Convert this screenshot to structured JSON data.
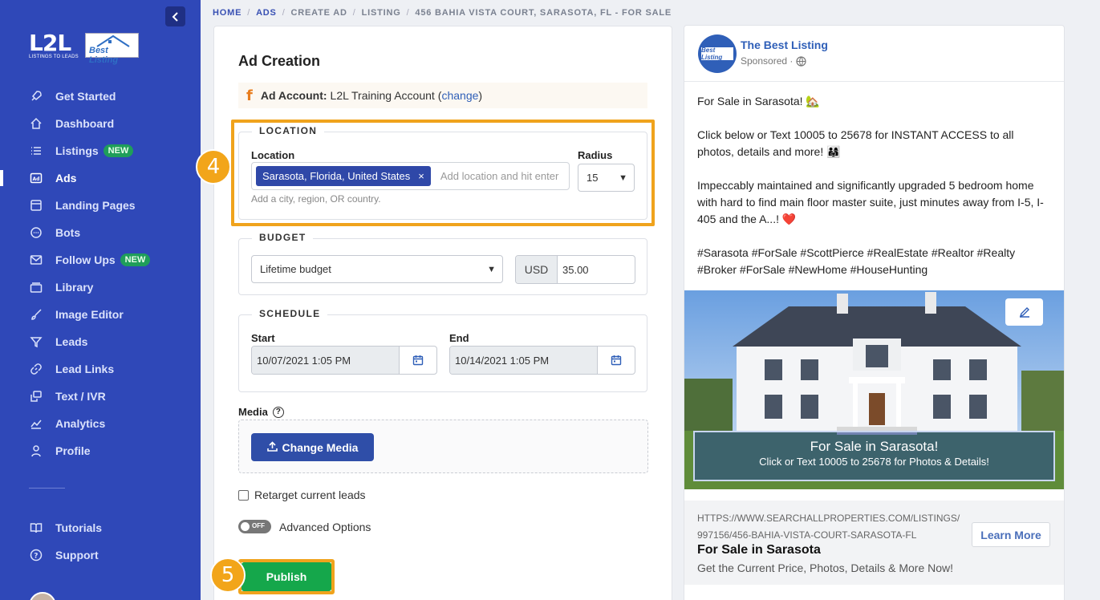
{
  "breadcrumb": {
    "home": "HOME",
    "ads": "ADS",
    "create_ad": "CREATE AD",
    "listing": "LISTING",
    "current": "456 BAHIA VISTA COURT, SARASOTA, FL - FOR SALE"
  },
  "sidebar": {
    "logo_text": "L2L",
    "logo_sub": "LISTINGS TO LEADS",
    "partner_logo": "Best Listing",
    "items": [
      {
        "label": "Get Started",
        "icon": "rocket-icon"
      },
      {
        "label": "Dashboard",
        "icon": "home-icon"
      },
      {
        "label": "Listings",
        "icon": "list-icon",
        "badge": "NEW"
      },
      {
        "label": "Ads",
        "icon": "ad-icon",
        "active": true
      },
      {
        "label": "Landing Pages",
        "icon": "page-icon"
      },
      {
        "label": "Bots",
        "icon": "chat-icon"
      },
      {
        "label": "Follow Ups",
        "icon": "mail-icon",
        "badge": "NEW"
      },
      {
        "label": "Library",
        "icon": "library-icon"
      },
      {
        "label": "Image Editor",
        "icon": "brush-icon"
      },
      {
        "label": "Leads",
        "icon": "filter-icon"
      },
      {
        "label": "Lead Links",
        "icon": "link-icon"
      },
      {
        "label": "Text / IVR",
        "icon": "text-icon"
      },
      {
        "label": "Analytics",
        "icon": "chart-icon"
      },
      {
        "label": "Profile",
        "icon": "user-icon"
      }
    ],
    "bottom_items": [
      {
        "label": "Tutorials",
        "icon": "book-icon"
      },
      {
        "label": "Support",
        "icon": "help-icon"
      }
    ]
  },
  "form": {
    "title": "Ad Creation",
    "account_label": "Ad Account:",
    "account_value": "L2L Training Account",
    "change_open": "(",
    "change_link": "change",
    "change_close": ")",
    "location": {
      "legend": "LOCATION",
      "label": "Location",
      "tag": "Sarasota, Florida, United States",
      "tag_remove": "×",
      "placeholder": "Add location and hit enter",
      "hint": "Add a city, region, OR country.",
      "radius_label": "Radius",
      "radius_value": "15"
    },
    "budget": {
      "legend": "BUDGET",
      "type": "Lifetime budget",
      "currency": "USD",
      "amount": "35.00"
    },
    "schedule": {
      "legend": "SCHEDULE",
      "start_label": "Start",
      "start_value": "10/07/2021 1:05 PM",
      "end_label": "End",
      "end_value": "10/14/2021 1:05 PM"
    },
    "media_label": "Media",
    "media_help": "?",
    "change_media": "Change Media",
    "retarget": "Retarget current leads",
    "toggle_state": "OFF",
    "advanced": "Advanced Options",
    "publish": "Publish"
  },
  "steps": {
    "location_step": "4",
    "publish_step": "5"
  },
  "preview": {
    "page_name": "The Best Listing",
    "sponsored": "Sponsored ·",
    "avatar_text": "Best Listing",
    "lines": [
      "For Sale in Sarasota! 🏡",
      "",
      "Click below or Text 10005 to 25678 for INSTANT ACCESS to all photos, details and more! 👨‍👩‍👧",
      "",
      "Impeccably maintained and significantly upgraded 5 bedroom home with hard to find main floor master suite, just minutes away from I-5, I-405 and the A...! ❤️",
      "",
      "#Sarasota #ForSale #ScottPierce #RealEstate #Realtor #Realty #Broker #ForSale #NewHome #HouseHunting"
    ],
    "image_title": "For Sale in Sarasota!",
    "image_sub": "Click or Text 10005 to 25678 for Photos & Details!",
    "url_line1": "HTTPS://WWW.SEARCHALLPROPERTIES.COM/LISTINGS/",
    "url_line2": "997156/456-BAHIA-VISTA-COURT-SARASOTA-FL",
    "headline": "For Sale in Sarasota",
    "description": "Get the Current Price, Photos, Details & More Now!",
    "cta": "Learn More"
  },
  "colors": {
    "sidebar": "#2f48b8",
    "highlight": "#f0a31c",
    "publish": "#15a74b",
    "primary_button": "#2f4ea8"
  }
}
